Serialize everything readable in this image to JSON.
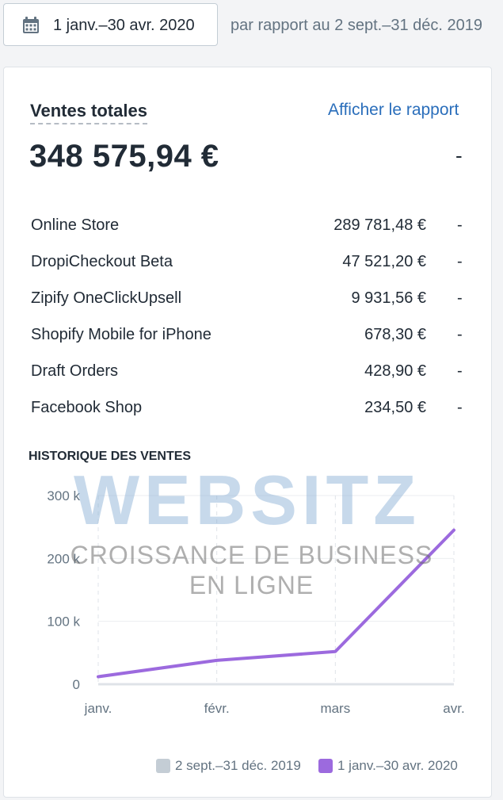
{
  "toolbar": {
    "date_range": "1 janv.–30 avr. 2020",
    "compare_text": "par rapport au 2 sept.–31 déc. 2019",
    "calendar_icon": "calendar-icon"
  },
  "card": {
    "title": "Ventes totales",
    "report_link": "Afficher le rapport",
    "total": "348 575,94 €",
    "total_delta": "-"
  },
  "channels": [
    {
      "name": "Online Store",
      "amount": "289 781,48 €",
      "delta": "-"
    },
    {
      "name": "DropiCheckout Beta",
      "amount": "47 521,20 €",
      "delta": "-"
    },
    {
      "name": "Zipify OneClickUpsell",
      "amount": "9 931,56 €",
      "delta": "-"
    },
    {
      "name": "Shopify Mobile for iPhone",
      "amount": "678,30 €",
      "delta": "-"
    },
    {
      "name": "Draft Orders",
      "amount": "428,90 €",
      "delta": "-"
    },
    {
      "name": "Facebook Shop",
      "amount": "234,50 €",
      "delta": "-"
    }
  ],
  "history": {
    "title": "HISTORIQUE DES VENTES"
  },
  "chart_data": {
    "type": "line",
    "categories": [
      "janv.",
      "févr.",
      "mars",
      "avr."
    ],
    "ytick_labels": [
      "0",
      "100 k",
      "200 k",
      "300 k"
    ],
    "ylim": [
      0,
      300000
    ],
    "series": [
      {
        "name": "2 sept.–31 déc. 2019",
        "values": [],
        "color": "#c4cdd5"
      },
      {
        "name": "1 janv.–30 avr. 2020",
        "values": [
          12000,
          38000,
          52000,
          245000
        ],
        "color": "#9c6ade"
      }
    ],
    "legend_position": "bottom-right",
    "grid": true
  },
  "watermark": {
    "brand": "WEBSITZ",
    "line1": "CROISSANCE DE BUSINESS",
    "line2": "EN LIGNE"
  }
}
